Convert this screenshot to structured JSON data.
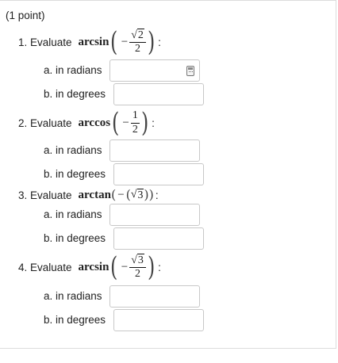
{
  "points": "(1 point)",
  "questions": [
    {
      "number": "1. Evaluate",
      "func": "arcsin",
      "minus": "−",
      "numerator_radicand": "2",
      "denominator": "2",
      "colon": ":",
      "parts": [
        {
          "label": "a. in radians",
          "value": ""
        },
        {
          "label": "b. in degrees",
          "value": ""
        }
      ]
    },
    {
      "number": "2. Evaluate",
      "func": "arccos",
      "minus": "−",
      "numerator": "1",
      "denominator": "2",
      "colon": ":",
      "parts": [
        {
          "label": "a. in radians",
          "value": ""
        },
        {
          "label": "b. in degrees",
          "value": ""
        }
      ]
    },
    {
      "number": "3. Evaluate",
      "func": "arctan",
      "minus": "−",
      "radicand": "3",
      "colon": ":",
      "parts": [
        {
          "label": "a. in radians",
          "value": ""
        },
        {
          "label": "b. in degrees",
          "value": ""
        }
      ]
    },
    {
      "number": "4. Evaluate",
      "func": "arcsin",
      "minus": "−",
      "numerator_radicand": "3",
      "denominator": "2",
      "colon": ":",
      "parts": [
        {
          "label": "a. in radians",
          "value": ""
        },
        {
          "label": "b. in degrees",
          "value": ""
        }
      ]
    }
  ],
  "icons": {
    "calculator": "calculator-icon"
  }
}
